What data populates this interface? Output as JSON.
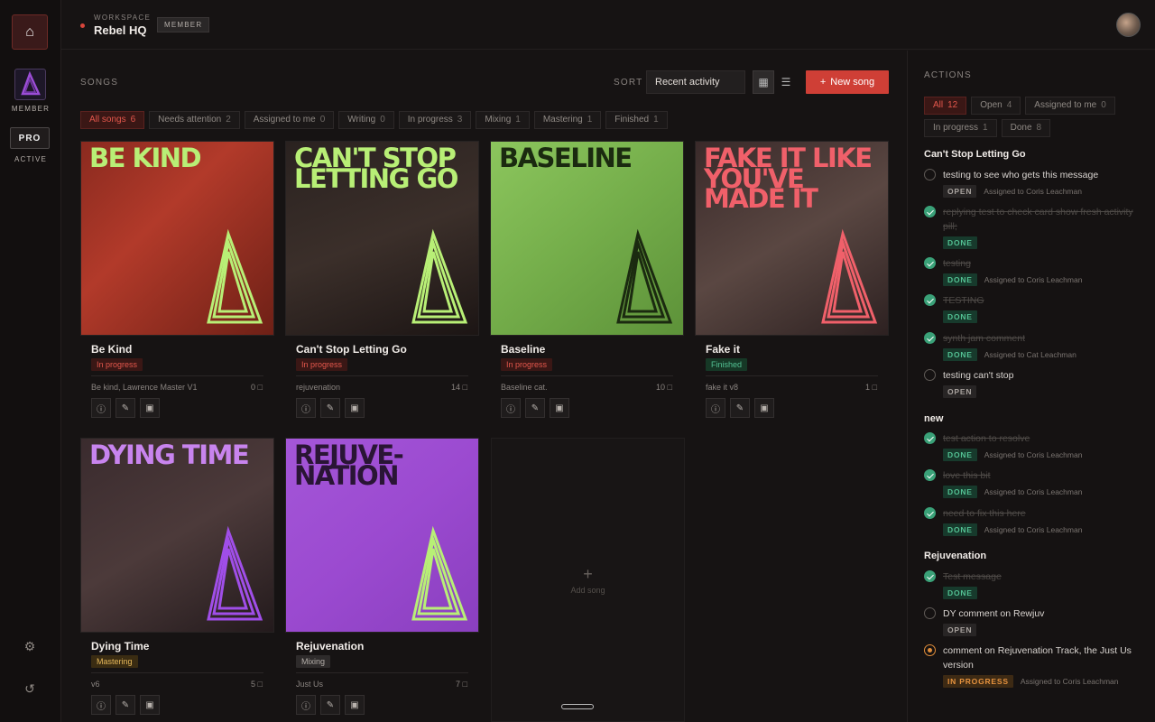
{
  "rail": {
    "member_label": "MEMBER",
    "plan": "PRO",
    "plan_status": "ACTIVE"
  },
  "workspace": {
    "label": "WORKSPACE",
    "name": "Rebel HQ",
    "role": "MEMBER"
  },
  "songs_header": {
    "label": "SONGS",
    "sort_label": "SORT",
    "sort_value": "Recent activity",
    "new_song": "New song"
  },
  "filters": [
    {
      "label": "All songs",
      "count": "6",
      "active": true
    },
    {
      "label": "Needs attention",
      "count": "2"
    },
    {
      "label": "Assigned to me",
      "count": "0"
    },
    {
      "label": "Writing",
      "count": "0"
    },
    {
      "label": "In progress",
      "count": "3"
    },
    {
      "label": "Mixing",
      "count": "1"
    },
    {
      "label": "Mastering",
      "count": "1"
    },
    {
      "label": "Finished",
      "count": "1"
    }
  ],
  "songs": [
    {
      "title": "Be Kind",
      "status": "In progress",
      "subtitle": "Be kind, Lawrence Master V1",
      "comments": "0",
      "art_text": "BE KIND"
    },
    {
      "title": "Can't Stop Letting Go",
      "status": "In progress",
      "subtitle": "rejuvenation",
      "comments": "14",
      "art_text": "CAN'T STOP LETTING GO"
    },
    {
      "title": "Baseline",
      "status": "In progress",
      "subtitle": "Baseline cat.",
      "comments": "10",
      "art_text": "BASELINE"
    },
    {
      "title": "Fake it",
      "status": "Finished",
      "subtitle": "fake it v8",
      "comments": "1",
      "art_text": "FAKE IT LIKE YOU'VE MADE IT"
    },
    {
      "title": "Dying Time",
      "status": "Mastering",
      "subtitle": "v6",
      "comments": "5",
      "art_text": "DYING TIME"
    },
    {
      "title": "Rejuvenation",
      "status": "Mixing",
      "subtitle": "Just Us",
      "comments": "7",
      "art_text": "REJUVE- NATION"
    }
  ],
  "add_song": "Add song",
  "actions": {
    "label": "ACTIONS",
    "filters": [
      {
        "label": "All",
        "count": "12",
        "active": true
      },
      {
        "label": "Open",
        "count": "4"
      },
      {
        "label": "Assigned to me",
        "count": "0"
      },
      {
        "label": "In progress",
        "count": "1"
      },
      {
        "label": "Done",
        "count": "8"
      }
    ],
    "groups": [
      {
        "title": "Can't Stop Letting Go",
        "items": [
          {
            "text": "testing to see who gets this message",
            "state": "OPEN",
            "assigned": "Assigned to Coris Leachman"
          },
          {
            "text": "replying test to check card show fresh activity pill;",
            "state": "DONE",
            "assigned": ""
          },
          {
            "text": "testing",
            "state": "DONE",
            "assigned": "Assigned to Coris Leachman"
          },
          {
            "text": "TESTING",
            "state": "DONE",
            "assigned": ""
          },
          {
            "text": "synth jam comment",
            "state": "DONE",
            "assigned": "Assigned to Cat Leachman"
          },
          {
            "text": "testing can't stop",
            "state": "OPEN",
            "assigned": ""
          }
        ]
      },
      {
        "title": "new",
        "items": [
          {
            "text": "test action to resolve",
            "state": "DONE",
            "assigned": "Assigned to Coris Leachman"
          },
          {
            "text": "love this bit",
            "state": "DONE",
            "assigned": "Assigned to Coris Leachman"
          },
          {
            "text": "need to fix this here",
            "state": "DONE",
            "assigned": "Assigned to Coris Leachman"
          }
        ]
      },
      {
        "title": "Rejuvenation",
        "items": [
          {
            "text": "Test message",
            "state": "DONE",
            "assigned": ""
          },
          {
            "text": "DY comment on Rewjuv",
            "state": "OPEN",
            "assigned": ""
          },
          {
            "text": "comment on Rejuvenation Track, the Just Us version",
            "state": "IN PROGRESS",
            "assigned": "Assigned to Coris Leachman"
          }
        ]
      }
    ]
  },
  "colors": {
    "accent": "#cf3f36",
    "done": "#3aa178",
    "in_progress": "#e08d3a"
  }
}
